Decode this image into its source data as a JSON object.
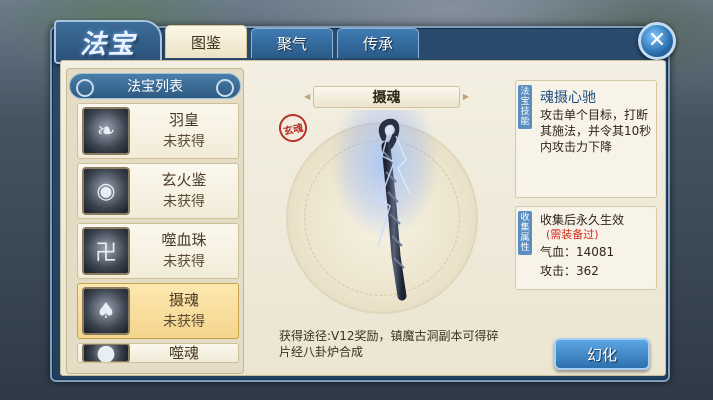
{
  "window": {
    "title": "法宝"
  },
  "tabs": [
    {
      "label": "图鉴",
      "active": true
    },
    {
      "label": "聚气",
      "active": false
    },
    {
      "label": "传承",
      "active": false
    }
  ],
  "list": {
    "header": "法宝列表",
    "items": [
      {
        "name": "羽皇",
        "status": "未获得",
        "icon": "feather-icon",
        "selected": false
      },
      {
        "name": "玄火鉴",
        "status": "未获得",
        "icon": "mirror-icon",
        "selected": false
      },
      {
        "name": "噬血珠",
        "status": "未获得",
        "icon": "orb-icon",
        "selected": false
      },
      {
        "name": "摄魂",
        "status": "未获得",
        "icon": "staff-icon",
        "selected": true
      },
      {
        "name": "噬魂",
        "status": "",
        "icon": "orb-icon",
        "selected": false
      }
    ]
  },
  "detail": {
    "name": "摄魂",
    "origin": "获得途径:V12奖励，镇魔古洞副本可得碎片经八卦炉合成"
  },
  "skill": {
    "tag": "法宝技能",
    "name": "魂摄心驰",
    "description": "攻击单个目标，打断其施法，并令其10秒内攻击力下降"
  },
  "attributes": {
    "tag": "收集属性",
    "title": "收集后永久生效",
    "note": "(需装备过)",
    "hp": "气血：14081",
    "attack": "攻击：362"
  },
  "buttons": {
    "refine": "幻化"
  },
  "colors": {
    "accent": "#2d6fad",
    "warning": "#d42a1e",
    "selected": "#f4d48c"
  }
}
